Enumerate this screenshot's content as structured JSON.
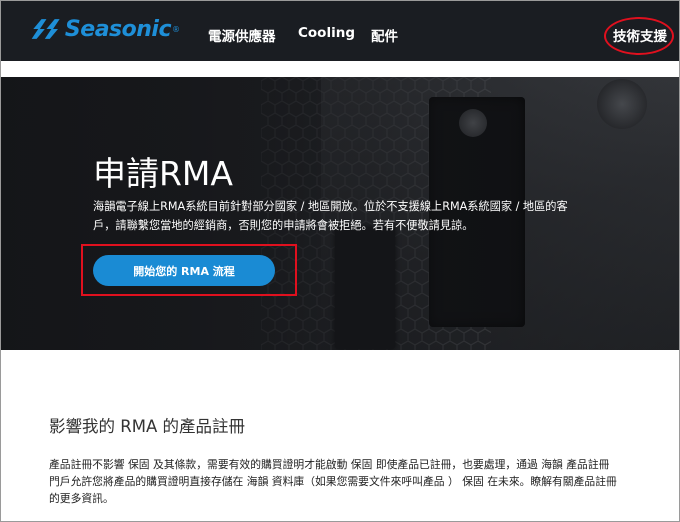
{
  "header": {
    "logo_text": "Seasonic",
    "logo_reg": "®",
    "nav": [
      {
        "label": "電源供應器"
      },
      {
        "label": "Cooling"
      },
      {
        "label": "配件"
      }
    ],
    "support_label": "技術支援"
  },
  "hero": {
    "title": "申請RMA",
    "description": "海韻電子線上RMA系統目前針對部分國家 / 地區開放。位於不支援線上RMA系統國家 / 地區的客戶，請聯繫您當地的經銷商，否則您的申請將會被拒絕。若有不便敬請見諒。",
    "cta_label": "開始您的 RMA 流程"
  },
  "section": {
    "title": "影響我的 RMA 的產品註冊",
    "body": "產品註冊不影響 保固 及其條款，需要有效的購買證明才能啟動 保固 即使產品已註冊，也要處理，通過 海韻 產品註冊門戶允許您將產品的購買證明直接存儲在 海韻 資料庫（如果您需要文件來呼叫產品 ） 保固 在未來。瞭解有關產品註冊的更多資訊。"
  },
  "colors": {
    "brand": "#1e8fd8",
    "cta": "#1a8bd4",
    "annotation": "#e0101e",
    "header_bg": "#1a1d22"
  }
}
